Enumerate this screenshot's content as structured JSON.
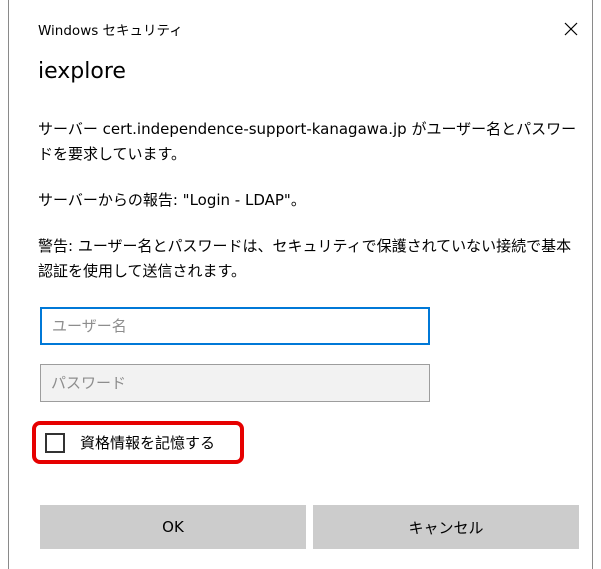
{
  "window": {
    "title": "Windows セキュリティ",
    "close_icon": "close-icon"
  },
  "app": {
    "name": "iexplore"
  },
  "messages": {
    "server_request": "サーバー cert.independence-support-kanagawa.jp がユーザー名とパスワードを要求しています。",
    "server_report": "サーバーからの報告: \"Login - LDAP\"。",
    "warning": "警告: ユーザー名とパスワードは、セキュリティで保護されていない接続で基本認証を使用して送信されます。"
  },
  "form": {
    "username": {
      "value": "",
      "placeholder": "ユーザー名"
    },
    "password": {
      "value": "",
      "placeholder": "パスワード"
    },
    "remember": {
      "label": "資格情報を記憶する",
      "checked": false,
      "highlight_color": "#e60000"
    }
  },
  "buttons": {
    "ok": "OK",
    "cancel": "キャンセル"
  },
  "colors": {
    "focus_border": "#0078d7",
    "button_bg": "#cccccc"
  }
}
